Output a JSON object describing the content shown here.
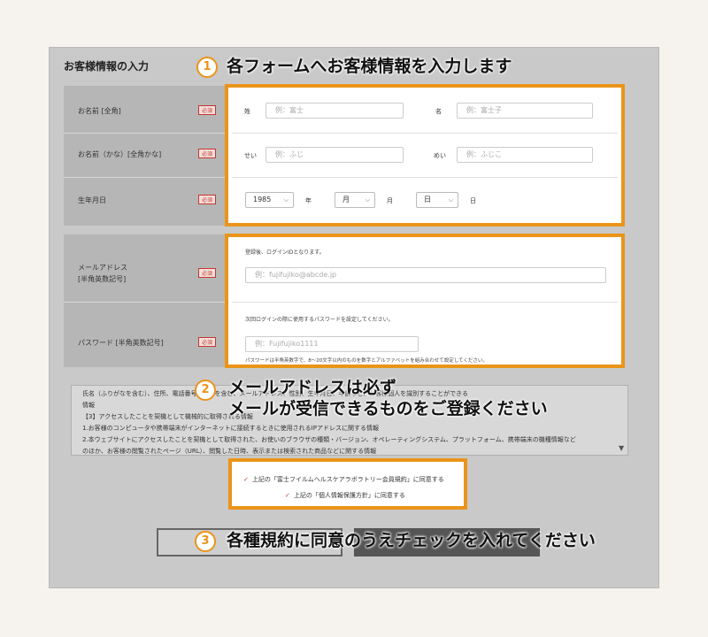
{
  "form": {
    "section_title": "お客様情報の入力",
    "required_badge": "必須",
    "name": {
      "label": "お名前 [全角]",
      "last_label": "姓",
      "last_placeholder": "例：富士",
      "first_label": "名",
      "first_placeholder": "例：富士子"
    },
    "kana": {
      "label": "お名前（かな）[全角かな]",
      "last_label": "せい",
      "last_placeholder": "例：ふじ",
      "first_label": "めい",
      "first_placeholder": "例：ふじこ"
    },
    "birth": {
      "label": "生年月日",
      "year_value": "1985",
      "year_unit": "年",
      "month_value": "月",
      "month_unit": "月",
      "day_value": "日",
      "day_unit": "日"
    },
    "email": {
      "label_line1": "メールアドレス",
      "label_line2": "[半角英数記号]",
      "note": "登録後、ログインIDとなります。",
      "placeholder": "例：fujifujiko@abcde.jp"
    },
    "password": {
      "label": "パスワード [半角英数記号]",
      "note": "次回ログインの際に使用するパスワードを設定してください。",
      "placeholder": "例：Fujifujiko1111",
      "hint": "パスワードは半角英数字で、8〜20文字以内のものを数字とアルファベットを組み合わせて設定してください。"
    }
  },
  "terms": {
    "lines": [
      "氏名（ふりがなを含む）、住所、電話番号、FAXを含む、メールアドレス、性別、生年月日、年齢など、お客様個人を識別することができる",
      "情報",
      "【3】アクセスしたことを契機として機械的に取得される情報",
      "1.お客様のコンピュータや携帯端末がインターネットに接続するときに使用されるIPアドレスに関する情報",
      "2.本ウェブサイトにアクセスしたことを契機として取得された、お使いのブラウザの種類・バージョン、オペレーティングシステム、プラットフォーム、携帯端末の機種情報など",
      "のほか、お客様の閲覧されたページ（URL）、閲覧した日時、表示または検索された商品などに関する情報"
    ]
  },
  "consent": {
    "check1": "上記の「富士フイルムヘルスケアラボラトリー会員規約」に同意する",
    "check2": "上記の「個人情報保護方針」に同意する"
  },
  "callouts": {
    "step1_number": "1",
    "step1_text": "各フォームへお客様情報を入力します",
    "step2_number": "2",
    "step2_line1": "メールアドレスは必ず",
    "step2_line2": "メールが受信できるものをご登録ください",
    "step3_number": "3",
    "step3_text": "各種規約に同意のうえチェックを入れてください"
  },
  "colors": {
    "accent": "#ea9419",
    "required": "#c0392b"
  }
}
